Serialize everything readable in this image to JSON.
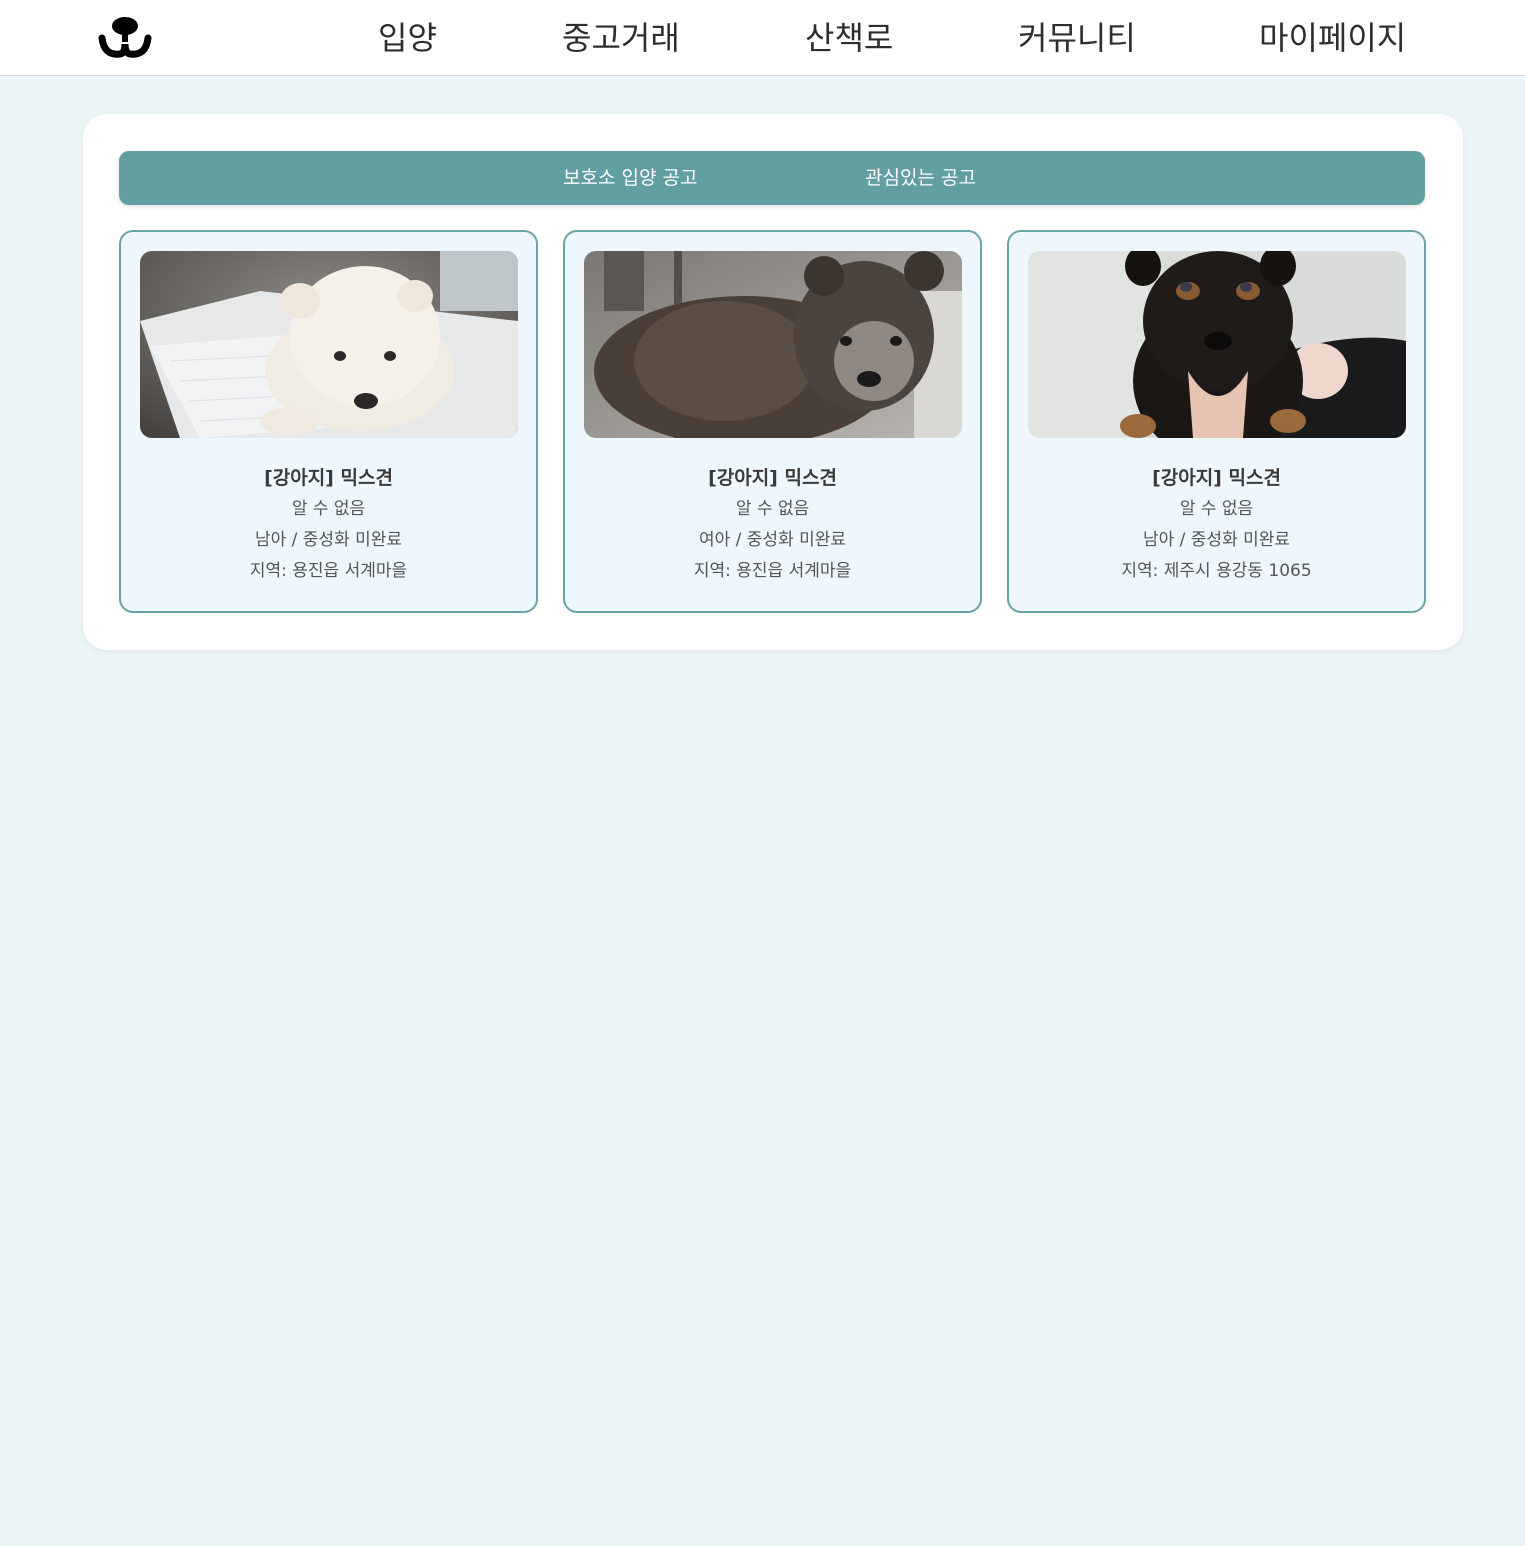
{
  "header": {
    "logo_icon": "dog-nose-logo-icon",
    "nav": [
      {
        "label": "입양"
      },
      {
        "label": "중고거래"
      },
      {
        "label": "산책로"
      },
      {
        "label": "커뮤니티"
      },
      {
        "label": "마이페이지"
      }
    ]
  },
  "tabs": [
    {
      "label": "보호소 입양 공고"
    },
    {
      "label": "관심있는 공고"
    }
  ],
  "colors": {
    "accent": "#619fa1",
    "card_border": "#6aa3a6",
    "card_bg": "#eef7fd",
    "page_bg": "#ebf4f6"
  },
  "cards": [
    {
      "image": "white-puppy-photo",
      "title": "[강아지] 믹스견",
      "age": "알 수 없음",
      "sex_neuter": "남아 / 중성화 미완료",
      "region": "지역: 용진읍 서계마을"
    },
    {
      "image": "gray-puppy-photo",
      "title": "[강아지] 믹스견",
      "age": "알 수 없음",
      "sex_neuter": "여아 / 중성화 미완료",
      "region": "지역: 용진읍 서계마을"
    },
    {
      "image": "black-tan-puppy-photo",
      "title": "[강아지] 믹스견",
      "age": "알 수 없음",
      "sex_neuter": "남아 / 중성화 미완료",
      "region": "지역: 제주시 용강동 1065"
    }
  ]
}
